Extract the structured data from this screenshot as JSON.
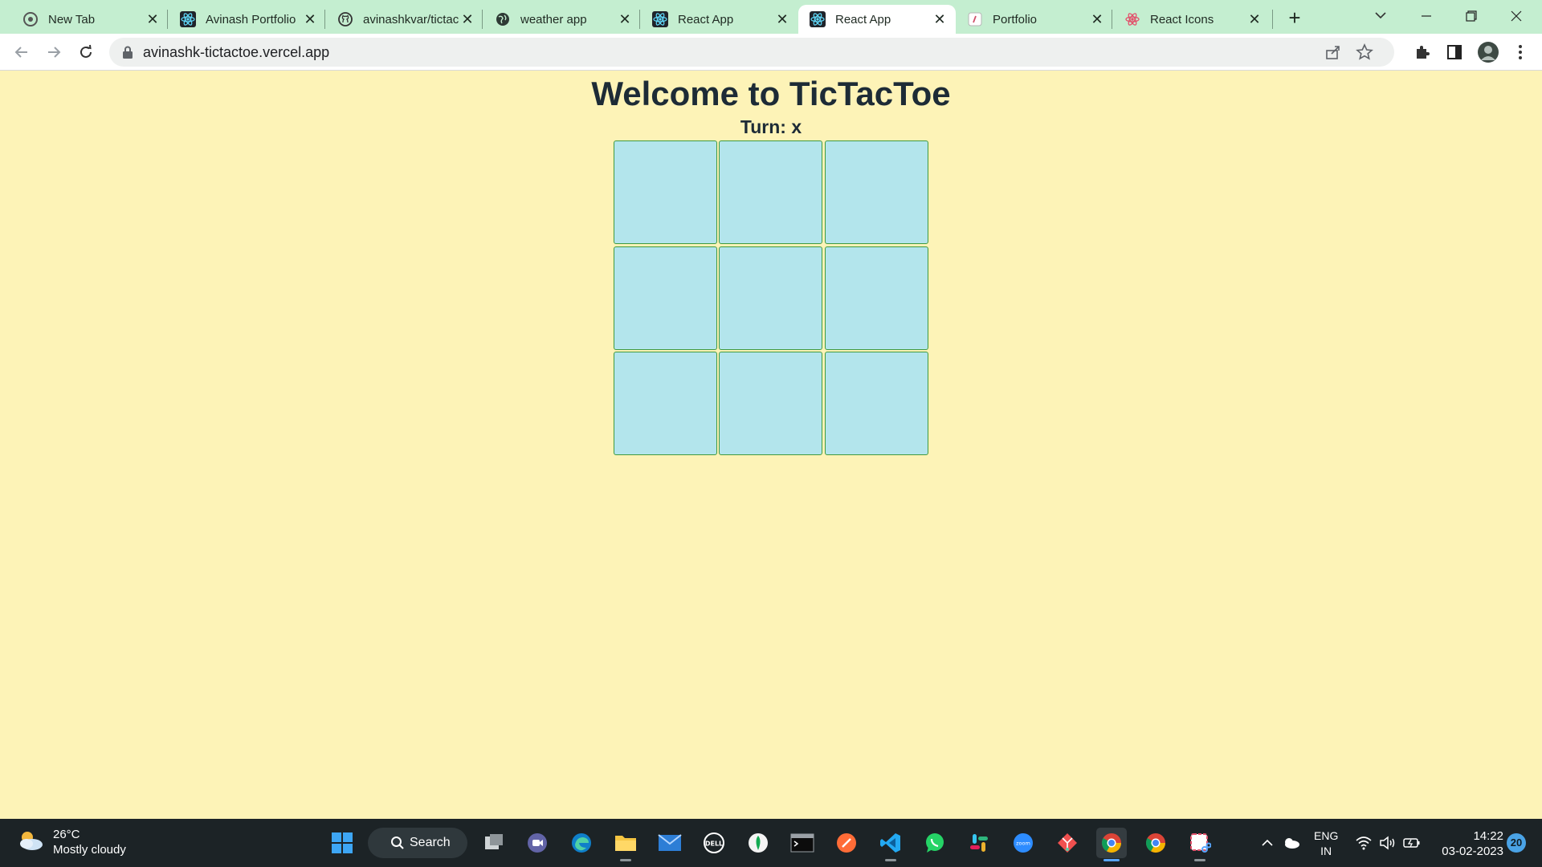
{
  "browser": {
    "tabs": [
      {
        "title": "New Tab",
        "icon": "chrome-icon"
      },
      {
        "title": "Avinash Portfolio",
        "icon": "react-icon"
      },
      {
        "title": "avinashkvar/tictac",
        "icon": "github-icon"
      },
      {
        "title": "weather app",
        "icon": "globe-icon"
      },
      {
        "title": "React App",
        "icon": "react-icon"
      },
      {
        "title": "React App",
        "icon": "react-icon"
      },
      {
        "title": "Portfolio",
        "icon": "portfolio-icon"
      },
      {
        "title": "React Icons",
        "icon": "react-icons-icon"
      }
    ],
    "active_tab_index": 5,
    "address": "avinashk-tictactoe.vercel.app"
  },
  "page": {
    "heading": "Welcome to TicTacToe",
    "turn": "Turn: x",
    "board": [
      "",
      "",
      "",
      "",
      "",
      "",
      "",
      "",
      ""
    ]
  },
  "taskbar": {
    "weather": {
      "temp": "26°C",
      "desc": "Mostly cloudy"
    },
    "search_label": "Search",
    "lang_line1": "ENG",
    "lang_line2": "IN",
    "time": "14:22",
    "date": "03-02-2023",
    "notifications": "20"
  },
  "colors": {
    "tab_strip": "#c4eed0",
    "page_background": "#fdf3b7",
    "cell_fill": "#b3e5ec",
    "cell_border": "#3f9a3f",
    "heading_text": "#1d2b36",
    "taskbar": "#1c2326"
  }
}
